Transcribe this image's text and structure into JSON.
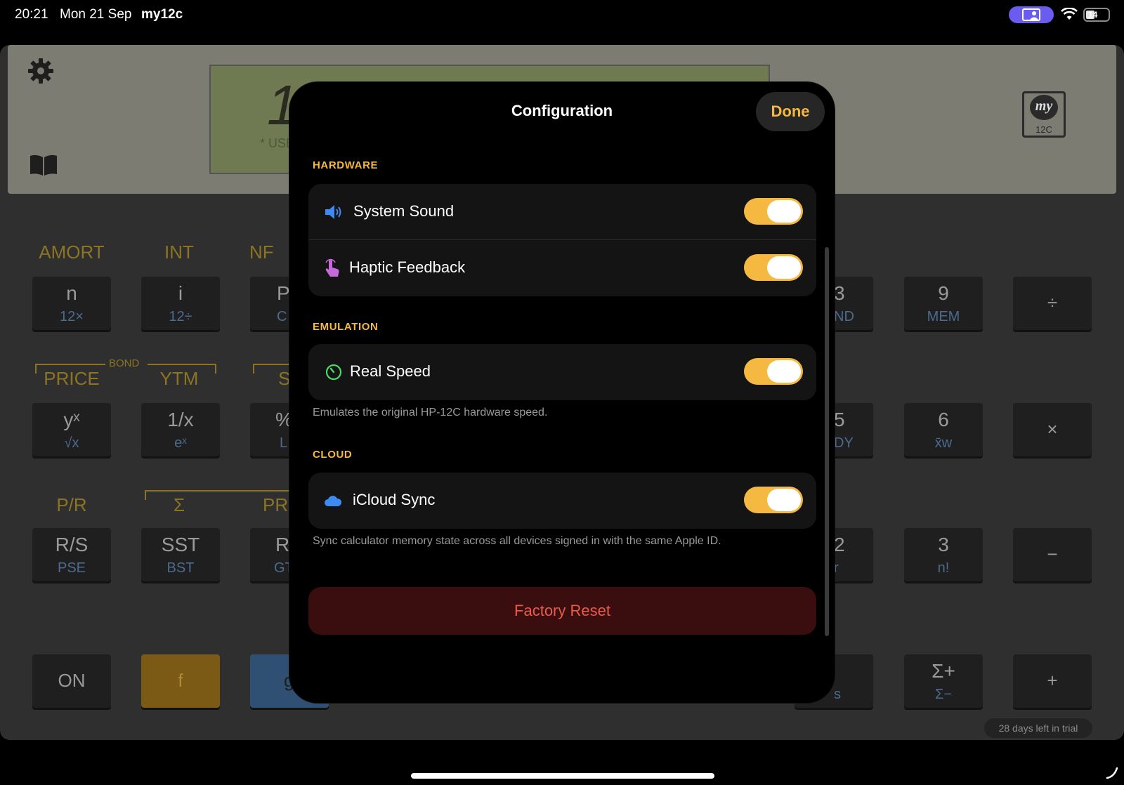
{
  "status_bar": {
    "time": "20:21",
    "date": "Mon 21 Sep",
    "app": "my12c",
    "battery": "14"
  },
  "calculator": {
    "lcd_digit": "1",
    "lcd_user": "* USE",
    "logo_my": "my",
    "logo_model": "12C",
    "trial_notice": "28 days left in trial",
    "rows": [
      {
        "labels": [
          "AMORT",
          "INT",
          "NF"
        ],
        "keys": [
          {
            "main": "n",
            "sub": "12×"
          },
          {
            "main": "i",
            "sub": "12÷"
          },
          {
            "main": "P",
            "sub": "C"
          },
          {
            "main": "3",
            "sub": "ND"
          },
          {
            "main": "9",
            "sub": "MEM"
          },
          {
            "main": "÷",
            "sub": ""
          }
        ]
      },
      {
        "bond_label": "BOND",
        "labels": [
          "PRICE",
          "YTM",
          "S"
        ],
        "keys": [
          {
            "main": "yˣ",
            "sub": "√x"
          },
          {
            "main": "1/x",
            "sub": "eˣ"
          },
          {
            "main": "%",
            "sub": "L"
          },
          {
            "main": "5",
            "sub": "DY"
          },
          {
            "main": "6",
            "sub": "x̄w"
          },
          {
            "main": "×",
            "sub": ""
          }
        ]
      },
      {
        "labels": [
          "P/R",
          "Σ",
          "PR"
        ],
        "keys": [
          {
            "main": "R/S",
            "sub": "PSE"
          },
          {
            "main": "SST",
            "sub": "BST"
          },
          {
            "main": "R",
            "sub": "GT"
          },
          {
            "main": "2",
            "sub": "r"
          },
          {
            "main": "3",
            "sub": "n!"
          },
          {
            "main": "−",
            "sub": ""
          }
        ]
      },
      {
        "keys": [
          {
            "main": "ON",
            "sub": ""
          },
          {
            "main": "f",
            "sub": ""
          },
          {
            "main": "g",
            "sub": ""
          },
          {
            "main": "",
            "sub": "s"
          },
          {
            "main": "Σ+",
            "sub": "Σ−"
          },
          {
            "main": "+",
            "sub": ""
          }
        ]
      }
    ]
  },
  "modal": {
    "title": "Configuration",
    "done_label": "Done",
    "sections": [
      {
        "heading": "HARDWARE",
        "rows": [
          {
            "label": "System Sound",
            "icon": "speaker-icon",
            "enabled": true
          },
          {
            "label": "Haptic Feedback",
            "icon": "hand-tap-icon",
            "enabled": true
          }
        ]
      },
      {
        "heading": "EMULATION",
        "rows": [
          {
            "label": "Real Speed",
            "icon": "speedometer-icon",
            "enabled": true
          }
        ],
        "footnote": "Emulates the original HP-12C hardware speed."
      },
      {
        "heading": "CLOUD",
        "rows": [
          {
            "label": "iCloud Sync",
            "icon": "cloud-icon",
            "enabled": true
          }
        ],
        "footnote": "Sync calculator memory state across all devices signed in with the same Apple ID."
      }
    ],
    "reset_label": "Factory Reset"
  },
  "colors": {
    "accent": "#f5b841",
    "danger_text": "#ec5a4c",
    "danger_bg": "#3a0e0e",
    "screen_share": "#6a5cf0"
  }
}
